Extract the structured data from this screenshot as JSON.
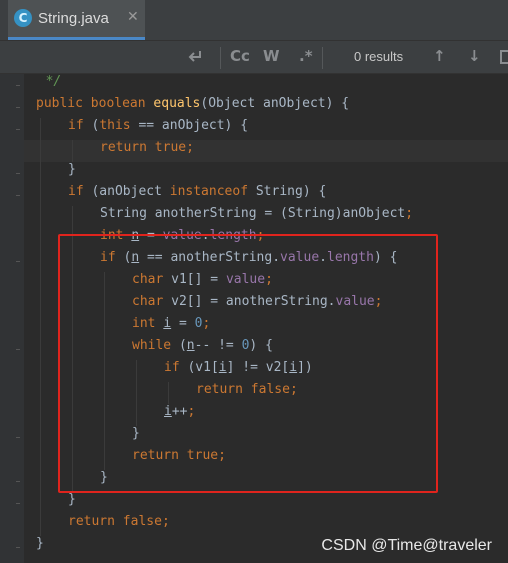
{
  "tab": {
    "icon": "java-class-icon",
    "icon_glyph": "C",
    "title": "String.java",
    "close_glyph": "✕"
  },
  "findbar": {
    "icons": [
      "replace-arrow-icon",
      "match-case-icon",
      "whole-words-icon",
      "regex-icon"
    ],
    "match_case_label": "Cc",
    "whole_words_label": "W",
    "regex_label": ".*",
    "results": "0 results",
    "prev_glyph": "↑",
    "next_glyph": "↓"
  },
  "code": [
    "*/",
    "public boolean equals(Object anObject) {",
    "if (this == anObject) {",
    "return true;",
    "}",
    "if (anObject instanceof String) {",
    "String anotherString = (String)anObject;",
    "int n = value.length;",
    "if (n == anotherString.value.length) {",
    "char v1[] = value;",
    "char v2[] = anotherString.value;",
    "int i = 0;",
    "while (n-- != 0) {",
    "if (v1[i] != v2[i])",
    "return false;",
    "i++;",
    "}",
    "return true;",
    "}",
    "}",
    "return false;",
    "}"
  ],
  "watermark": "CSDN @Time@traveler",
  "colors": {
    "keyword": "#cc7832",
    "method": "#ffc66d",
    "field": "#9876aa",
    "number": "#6897bb",
    "comment": "#629755",
    "highlight_box": "#e0241d"
  }
}
